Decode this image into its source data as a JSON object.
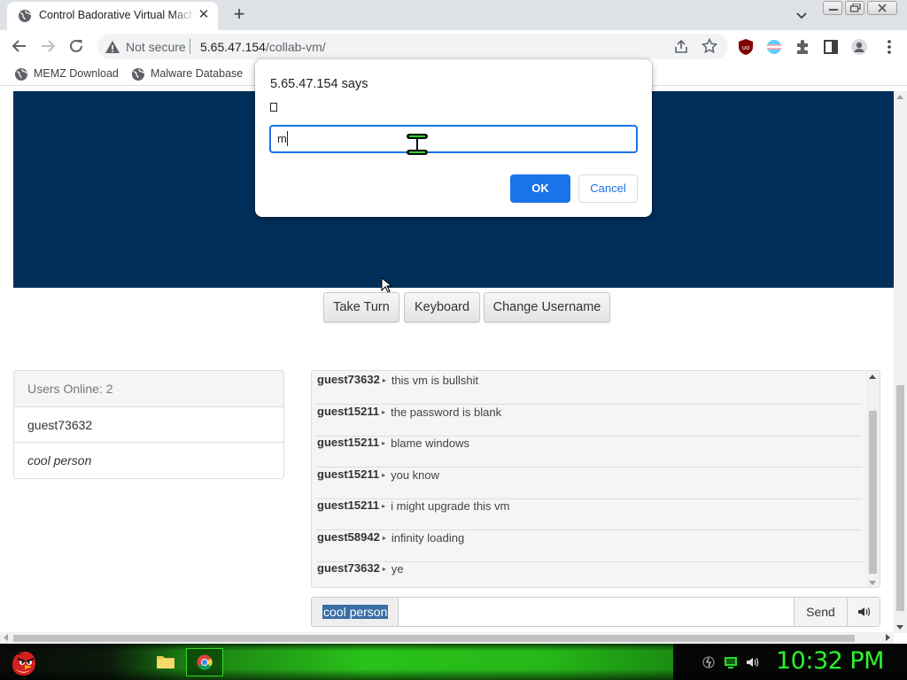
{
  "browser": {
    "tab_title": "Control Badorative Virtual Machine",
    "tab_close": "✕",
    "new_tab": "+",
    "not_secure": "Not secure",
    "url_host": "5.65.47.154",
    "url_path": "/collab-vm/",
    "bookmarks": [
      {
        "label": "MEMZ Download"
      },
      {
        "label": "Malware Database"
      }
    ],
    "extension_icons": [
      "ublock-icon",
      "trans-flag-icon",
      "puzzle-icon",
      "side-panel-icon",
      "profile-icon",
      "kebab-menu-icon"
    ]
  },
  "dialog": {
    "title": "5.65.47.154 says",
    "input_value": "m",
    "ok_label": "OK",
    "cancel_label": "Cancel"
  },
  "vm": {
    "buttons": {
      "take_turn": "Take Turn",
      "keyboard": "Keyboard",
      "change_username": "Change Username"
    }
  },
  "users": {
    "header": "Users Online: 2",
    "list": [
      "guest73632",
      "cool person"
    ]
  },
  "chat": {
    "messages": [
      {
        "user": "guest73632",
        "text": "this vm is bullshit"
      },
      {
        "user": "guest15211",
        "text": "the password is blank"
      },
      {
        "user": "guest15211",
        "text": "blame windows"
      },
      {
        "user": "guest15211",
        "text": "you know"
      },
      {
        "user": "guest15211",
        "text": "i might upgrade this vm"
      },
      {
        "user": "guest58942",
        "text": "infinity loading"
      },
      {
        "user": "guest73632",
        "text": "ye"
      }
    ],
    "username": "cool person",
    "send_label": "Send"
  },
  "taskbar": {
    "clock": "10:32 PM"
  },
  "colors": {
    "vm_background": "#00305a",
    "accent_blue": "#1a73e8",
    "taskbar_green": "#29c11a",
    "clock_green": "#2cf52c"
  }
}
